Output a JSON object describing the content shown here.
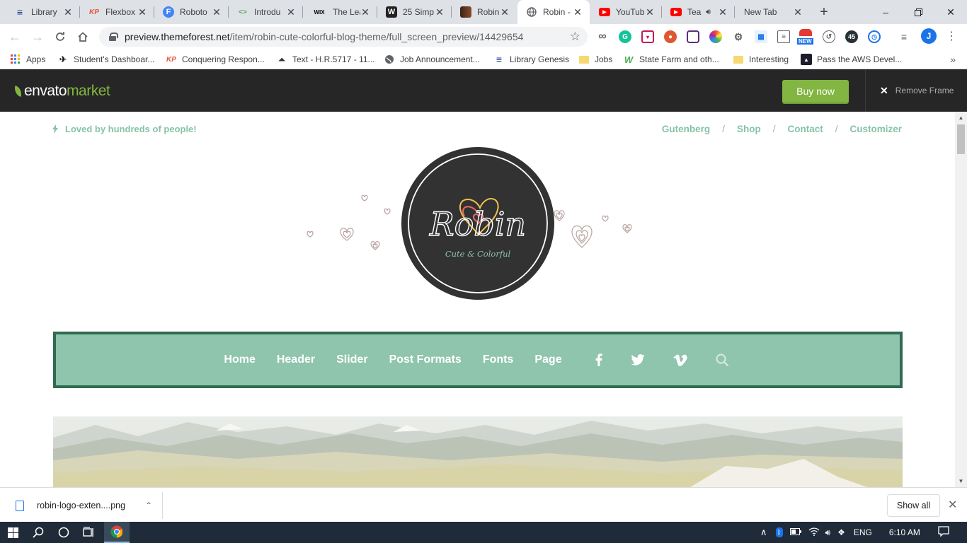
{
  "browser": {
    "tabs": [
      {
        "title": "Library",
        "icon": "library-genesis-icon",
        "color": "#1a3a8a",
        "glyph": "≡"
      },
      {
        "title": "Flexbox",
        "icon": "kp-icon",
        "color": "#e8543a",
        "glyph": "KP"
      },
      {
        "title": "Roboto",
        "icon": "google-fonts-icon",
        "color": "#4285f4",
        "glyph": "F"
      },
      {
        "title": "Introdu",
        "icon": "code-icon",
        "color": "#2a2a2a",
        "glyph": "<>"
      },
      {
        "title": "The Lea",
        "icon": "wix-icon",
        "color": "#000000",
        "glyph": "WIX"
      },
      {
        "title": "25 Simp",
        "icon": "w-icon",
        "color": "#222222",
        "glyph": "W"
      },
      {
        "title": "Robin -",
        "icon": "robin-thumb-icon",
        "color": "#8b4a2a",
        "glyph": ""
      },
      {
        "title": "Robin -",
        "icon": "globe-icon",
        "color": "#5f6368",
        "glyph": "◍",
        "active": true
      },
      {
        "title": "YouTub",
        "icon": "youtube-icon",
        "color": "#ff0000",
        "glyph": "▶"
      },
      {
        "title": "Tea",
        "icon": "youtube-icon",
        "color": "#ff0000",
        "glyph": "▶",
        "audio": true
      },
      {
        "title": "New Tab",
        "icon": "",
        "color": "",
        "glyph": ""
      }
    ],
    "url_host": "preview.themeforest.net",
    "url_path": "/item/robin-cute-colorful-blog-theme/full_screen_preview/14429654",
    "profile_initial": "J",
    "ext_badge_new": "NEW",
    "ext_badge_45": "45",
    "bookmarks": [
      {
        "label": "Apps",
        "icon": "apps-grid-icon"
      },
      {
        "label": "Student's Dashboar...",
        "icon": "bird-icon"
      },
      {
        "label": "Conquering Respon...",
        "icon": "kp-icon"
      },
      {
        "label": "Text - H.R.5717 - 11...",
        "icon": "capitol-icon"
      },
      {
        "label": "Job Announcement...",
        "icon": "globe-icon"
      },
      {
        "label": "Library Genesis",
        "icon": "library-genesis-icon"
      },
      {
        "label": "Jobs",
        "icon": "folder-icon"
      },
      {
        "label": "State Farm and oth...",
        "icon": "w-green-icon"
      },
      {
        "label": "Interesting",
        "icon": "folder-icon"
      },
      {
        "label": "Pass the AWS Devel...",
        "icon": "acloud-icon"
      }
    ]
  },
  "envato": {
    "logo_word1": "envato",
    "logo_word2": "market",
    "buy_now": "Buy now",
    "remove_frame": "Remove Frame"
  },
  "site": {
    "tagline": "Loved by hundreds of people!",
    "top_links": [
      "Gutenberg",
      "Shop",
      "Contact",
      "Customizer"
    ],
    "logo_title": "Robin",
    "logo_subtitle": "Cute & Colorful",
    "menu": [
      "Home",
      "Header",
      "Slider",
      "Post Formats",
      "Fonts",
      "Page"
    ],
    "social": [
      "facebook-icon",
      "twitter-icon",
      "vimeo-icon",
      "search-icon"
    ]
  },
  "download": {
    "file": "robin-logo-exten....png",
    "show_all": "Show all"
  },
  "taskbar": {
    "lang": "ENG",
    "time": "6:10 AM"
  },
  "colors": {
    "accent_green": "#86c3a7",
    "nav_bg": "#8fc4ad",
    "nav_border": "#2f6b50",
    "envato_green": "#82b541",
    "logo_dark": "#323232"
  }
}
